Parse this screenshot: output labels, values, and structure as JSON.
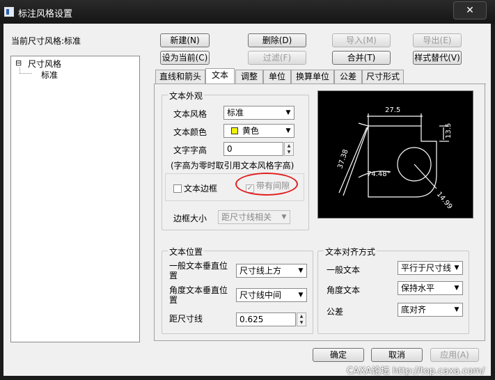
{
  "window": {
    "title": "标注风格设置",
    "close_glyph": "✕"
  },
  "left": {
    "current_style_label": "当前尺寸风格:标准",
    "tree": {
      "root": "尺寸风格",
      "child": "标准",
      "expander": "⊟"
    }
  },
  "toolbar": {
    "new": "新建(N)",
    "delete": "删除(D)",
    "import": "导入(M)",
    "export": "导出(E)",
    "set_current": "设为当前(C)",
    "filter": "过滤(F)",
    "merge": "合并(T)",
    "style_replace": "样式替代(V)"
  },
  "tabs": [
    "直线和箭头",
    "文本",
    "调整",
    "单位",
    "换算单位",
    "公差",
    "尺寸形式"
  ],
  "text_appearance": {
    "group": "文本外观",
    "style_label": "文本风格",
    "style_value": "标准",
    "color_label": "文本颜色",
    "color_value": "黄色",
    "color_swatch": "#f2f200",
    "height_label": "文字字高",
    "height_value": "0",
    "height_note": "(字高为零时取引用文本风格字高)",
    "frame_label": "文本边框",
    "gap_label": "带有间隙",
    "frame_size_label": "边框大小",
    "frame_size_value": "距尺寸线相关"
  },
  "text_position": {
    "group": "文本位置",
    "vertical_label": "一般文本垂直位置",
    "vertical_value": "尺寸线上方",
    "angle_label": "角度文本垂直位置",
    "angle_value": "尺寸线中间",
    "dist_label": "距尺寸线",
    "dist_value": "0.625"
  },
  "text_align": {
    "group": "文本对齐方式",
    "general_label": "一般文本",
    "general_value": "平行于尺寸线",
    "angle_label": "角度文本",
    "angle_value": "保持水平",
    "tol_label": "公差",
    "tol_value": "底对齐"
  },
  "preview": {
    "dim1": "27.5",
    "dim2": "13.5",
    "dim3": "37.38",
    "dim4": "74.48°",
    "dim5": "14.99"
  },
  "footer": {
    "ok": "确定",
    "cancel": "取消",
    "apply": "应用(A)"
  },
  "watermark": "CAXA论坛 http://top.caxa.com/"
}
